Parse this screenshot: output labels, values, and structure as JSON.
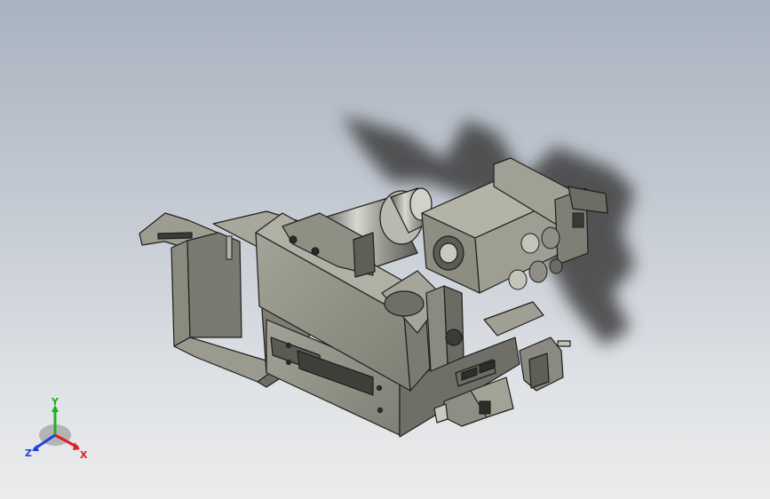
{
  "view": {
    "background_top": "#a9b2c0",
    "background_bottom": "#ececec",
    "part_color": "#8c8c82",
    "part_edge_color": "#1e1e1e",
    "shadow_color": "#4a4a4a"
  },
  "triad": {
    "x_label": "X",
    "y_label": "Y",
    "z_label": "Z",
    "x_color": "#e02020",
    "y_color": "#20b020",
    "z_color": "#2040e0"
  }
}
